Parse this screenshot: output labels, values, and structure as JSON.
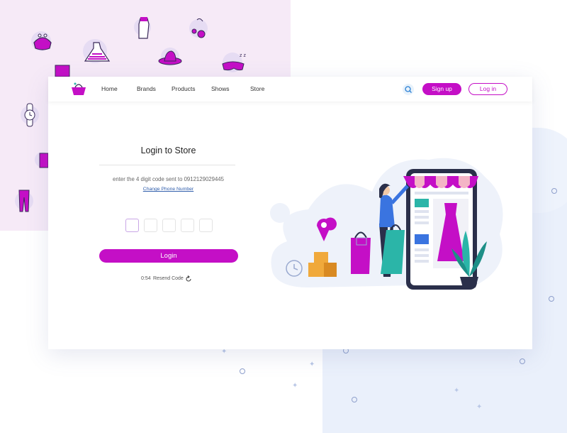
{
  "nav": {
    "links": [
      "Home",
      "Brands",
      "Products",
      "Shows",
      "Store"
    ],
    "signup_label": "Sign up",
    "login_label": "Log in"
  },
  "form": {
    "title": "Login to Store",
    "subtitle": "enter the 4 digit code sent to 0912129029445",
    "change_phone_label": "Change Phone Number",
    "code_fields": [
      "",
      "",
      "",
      "",
      ""
    ],
    "login_button_label": "Login",
    "timer": "0:54",
    "resend_label": "Resend Code"
  },
  "icons": {
    "logo": "shopping-basket-icon",
    "search": "search-icon",
    "reload": "reload-icon"
  },
  "colors": {
    "accent": "#c40fc6",
    "link": "#2f5dab",
    "background_pink": "#f6eaf7",
    "background_blue": "#eaf0fb"
  }
}
